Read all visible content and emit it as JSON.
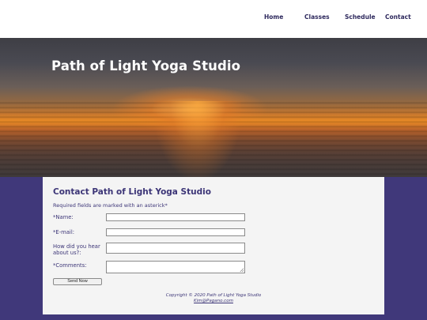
{
  "nav": {
    "items": [
      "Home",
      "Classes",
      "Schedule",
      "Contact"
    ]
  },
  "hero": {
    "title": "Path of Light Yoga Studio"
  },
  "form": {
    "heading": "Contact Path of Light Yoga Studio",
    "required_note": "Required fields are marked with an asterick*",
    "name_label": "*Name:",
    "name_value": "",
    "email_label": "*E-mail:",
    "email_value": "",
    "how_label": "How did you hear about us?:",
    "how_value": "",
    "comments_label": "*Comments:",
    "comments_value": "",
    "submit_label": "Send Now"
  },
  "footer": {
    "copyright": "Copyright © 2020 Path of Light Yoga Studio",
    "email": "Kim@Pagano.com"
  },
  "colors": {
    "brand_purple": "#40387a",
    "text_purple": "#3c3577",
    "panel_bg": "#f4f4f4"
  }
}
